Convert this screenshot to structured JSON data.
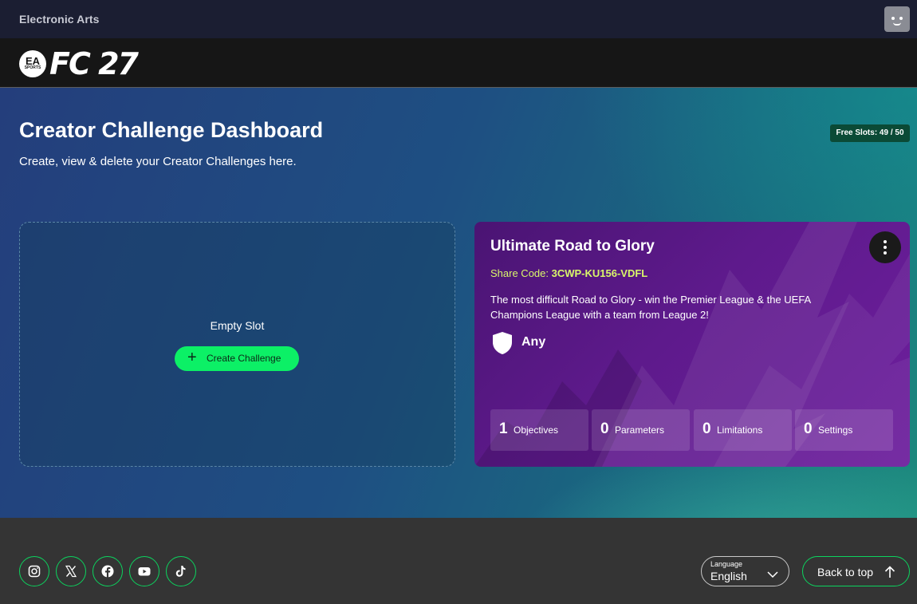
{
  "ea_bar": {
    "brand": "Electronic Arts",
    "avatar_icon": "user-face-icon"
  },
  "game_bar": {
    "badge": "EA",
    "badge_small": "SPORTS",
    "logo": "FC 27"
  },
  "page": {
    "title": "Creator Challenge Dashboard",
    "subtitle": "Create, view & delete your Creator Challenges here.",
    "slots_badge": "Free Slots: 49 / 50"
  },
  "empty_slot": {
    "label": "Empty Slot",
    "button_label": "Create Challenge"
  },
  "challenge_card": {
    "title": "Ultimate Road to Glory",
    "share_label": "Share Code:",
    "share_code": "3CWP-KU156-VDFL",
    "description": "The most difficult Road to Glory - win the Premier League & the UEFA Champions League with a team from League 2!",
    "team": "Any",
    "stats": [
      {
        "count": "1",
        "label": "Objectives"
      },
      {
        "count": "0",
        "label": "Parameters"
      },
      {
        "count": "0",
        "label": "Limitations"
      },
      {
        "count": "0",
        "label": "Settings"
      }
    ]
  },
  "footer": {
    "socials": [
      "instagram-icon",
      "x-icon",
      "facebook-icon",
      "youtube-icon",
      "tiktok-icon"
    ],
    "language_caption": "Language",
    "language_value": "English",
    "back_to_top": "Back to top"
  },
  "colors": {
    "accent_green": "#0cf066",
    "card_purple": "#5e1a8c",
    "share_code": "#d9f76a",
    "slots_badge_bg": "#0b4a36"
  }
}
